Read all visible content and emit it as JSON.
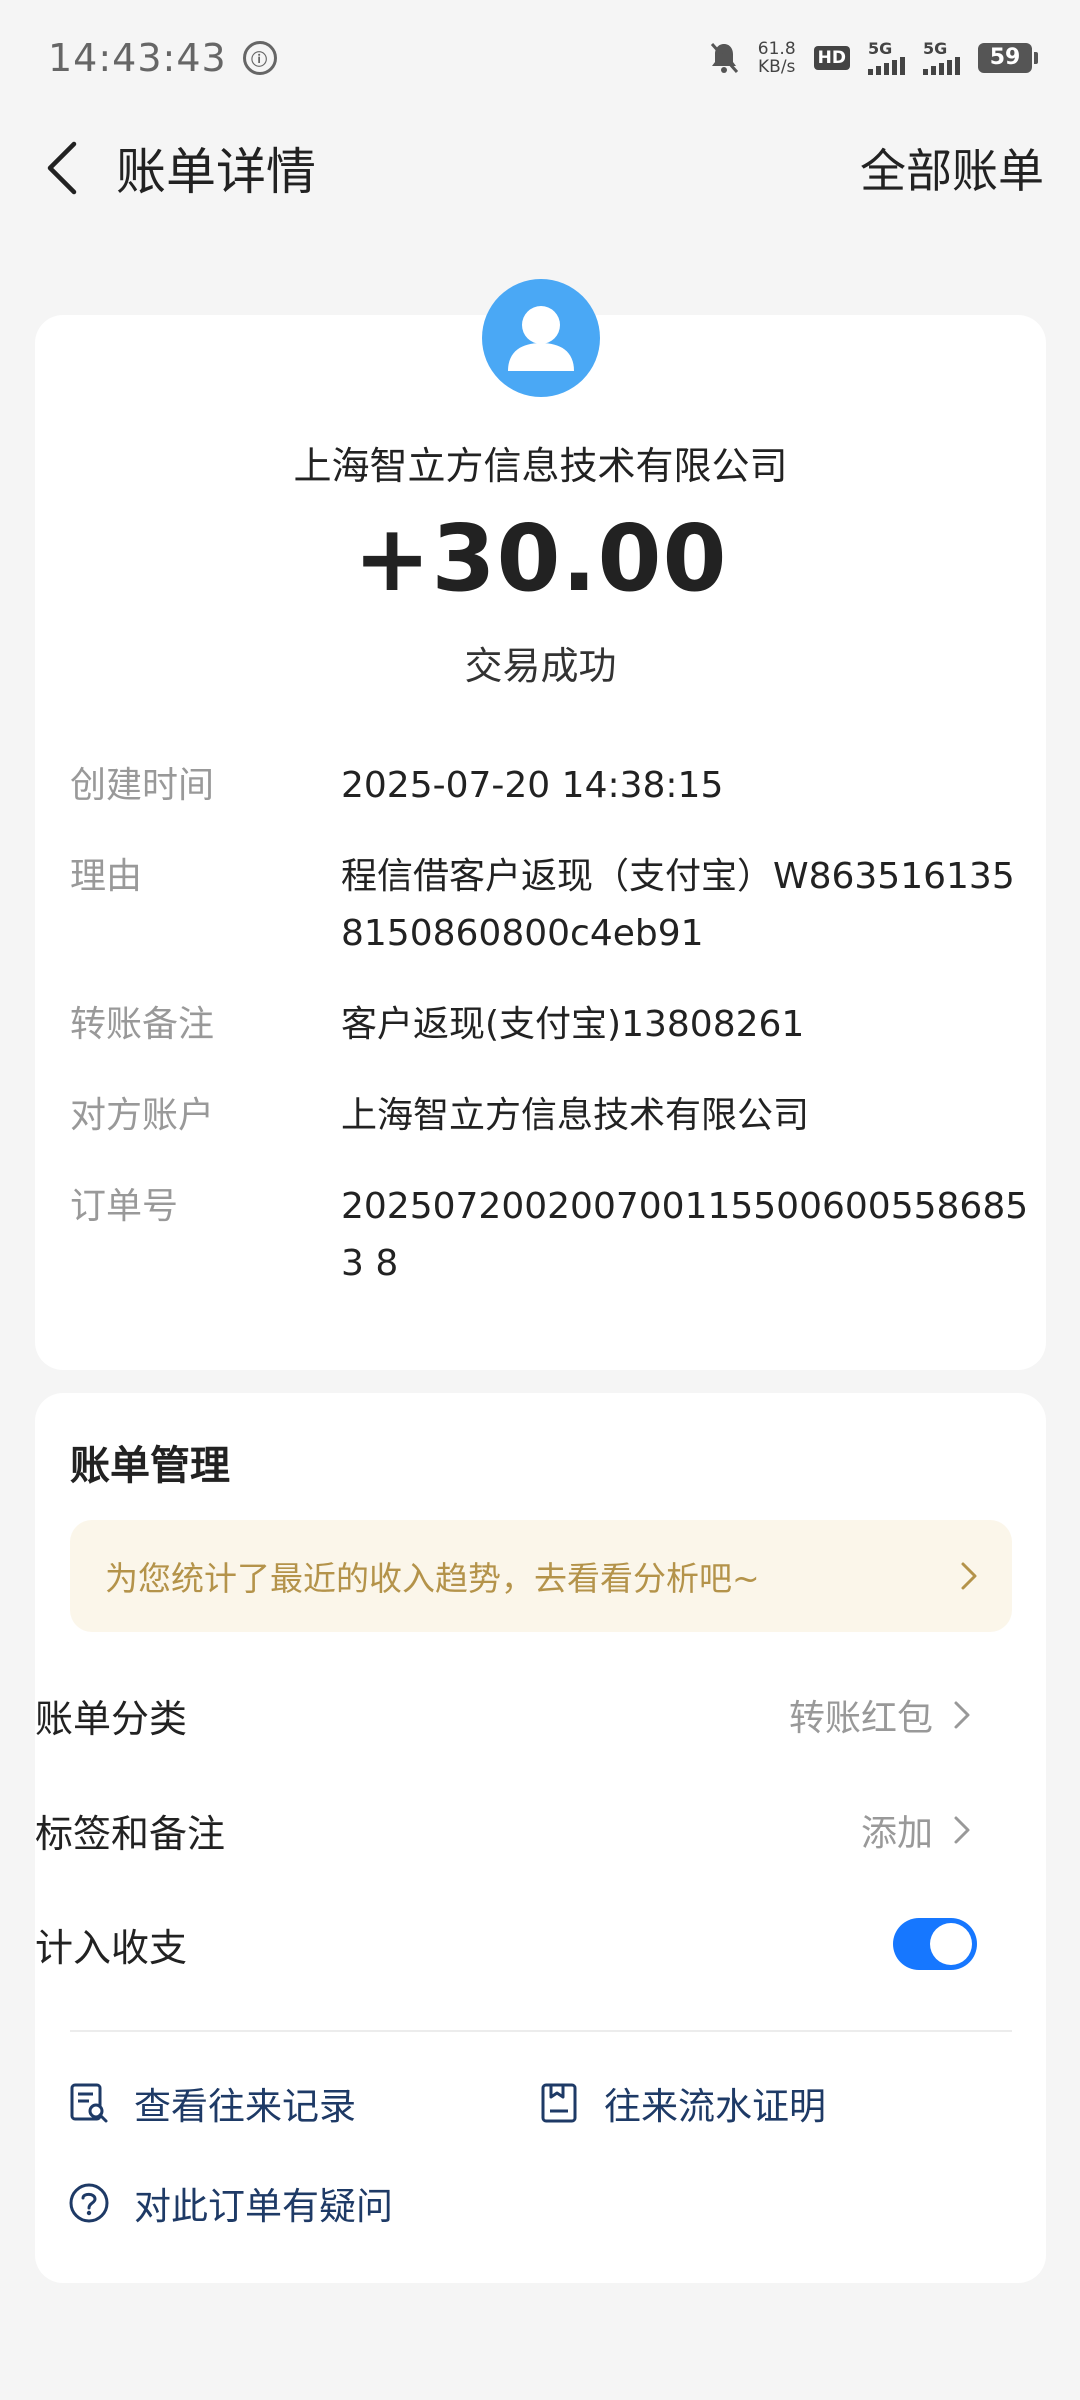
{
  "status_bar": {
    "time": "14:43:43",
    "net_speed_value": "61.8",
    "net_speed_unit": "KB/s",
    "hd": "HD",
    "sim1": "5G",
    "sim2": "5G",
    "battery": "59"
  },
  "nav": {
    "title": "账单详情",
    "all_bills": "全部账单"
  },
  "transaction": {
    "merchant": "上海智立方信息技术有限公司",
    "amount": "+30.00",
    "status": "交易成功"
  },
  "details": [
    {
      "label": "创建时间",
      "value": "2025-07-20 14:38:15"
    },
    {
      "label": "理由",
      "value": "程信借客户返现（支付宝）W8635161358150860800c4eb91"
    },
    {
      "label": "转账备注",
      "value": "客户返现(支付宝)13808261"
    },
    {
      "label": "对方账户",
      "value": "上海智立方信息技术有限公司"
    },
    {
      "label": "订单号",
      "value": "2025072002007001155006005586853 8"
    }
  ],
  "manage": {
    "title": "账单管理",
    "trend_banner": "为您统计了最近的收入趋势，去看看分析吧~",
    "category_label": "账单分类",
    "category_value": "转账红包",
    "tags_label": "标签和备注",
    "tags_value": "添加",
    "income_label": "计入收支",
    "income_toggle_on": true
  },
  "links": {
    "records": "查看往来记录",
    "proof": "往来流水证明",
    "question": "对此订单有疑问"
  },
  "colors": {
    "accent": "#1677ff",
    "avatar_bg": "#4aa8f5",
    "banner_bg": "#fbf6ea",
    "banner_text": "#b4934a",
    "link_text": "#1e3a66"
  }
}
